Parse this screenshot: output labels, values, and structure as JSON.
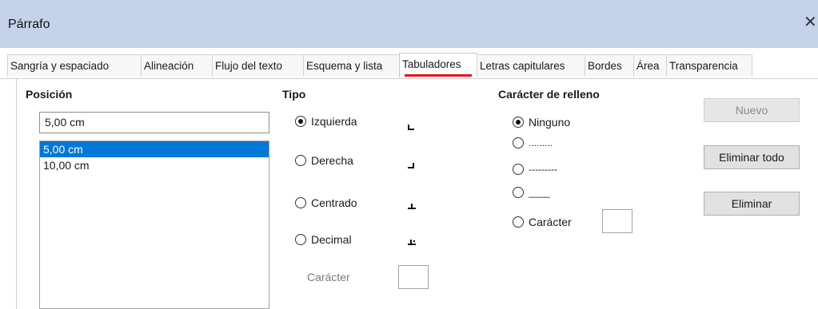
{
  "window": {
    "title": "Párrafo"
  },
  "tabs": [
    {
      "label": "Sangría y espaciado"
    },
    {
      "label": "Alineación"
    },
    {
      "label": "Flujo del texto"
    },
    {
      "label": "Esquema y lista"
    },
    {
      "label": "Tabuladores"
    },
    {
      "label": "Letras capitulares"
    },
    {
      "label": "Bordes"
    },
    {
      "label": "Área"
    },
    {
      "label": "Transparencia"
    }
  ],
  "active_tab": "Tabuladores",
  "position": {
    "label": "Posición",
    "value": "5,00 cm",
    "items": [
      "5,00 cm",
      "10,00 cm"
    ],
    "selected_item": "5,00 cm"
  },
  "type": {
    "label": "Tipo",
    "options": [
      {
        "label": "Izquierda",
        "checked": true
      },
      {
        "label": "Derecha",
        "checked": false
      },
      {
        "label": "Centrado",
        "checked": false
      },
      {
        "label": "Decimal",
        "checked": false
      }
    ],
    "char_label": "Carácter"
  },
  "fill": {
    "label": "Carácter de relleno",
    "options": [
      {
        "label": "Ninguno",
        "checked": true
      },
      {
        "label": ".........",
        "checked": false
      },
      {
        "label": "---------",
        "checked": false
      },
      {
        "label": "____",
        "checked": false
      },
      {
        "label": "Carácter",
        "checked": false
      }
    ]
  },
  "buttons": {
    "new": "Nuevo",
    "delete_all": "Eliminar todo",
    "delete": "Eliminar"
  }
}
